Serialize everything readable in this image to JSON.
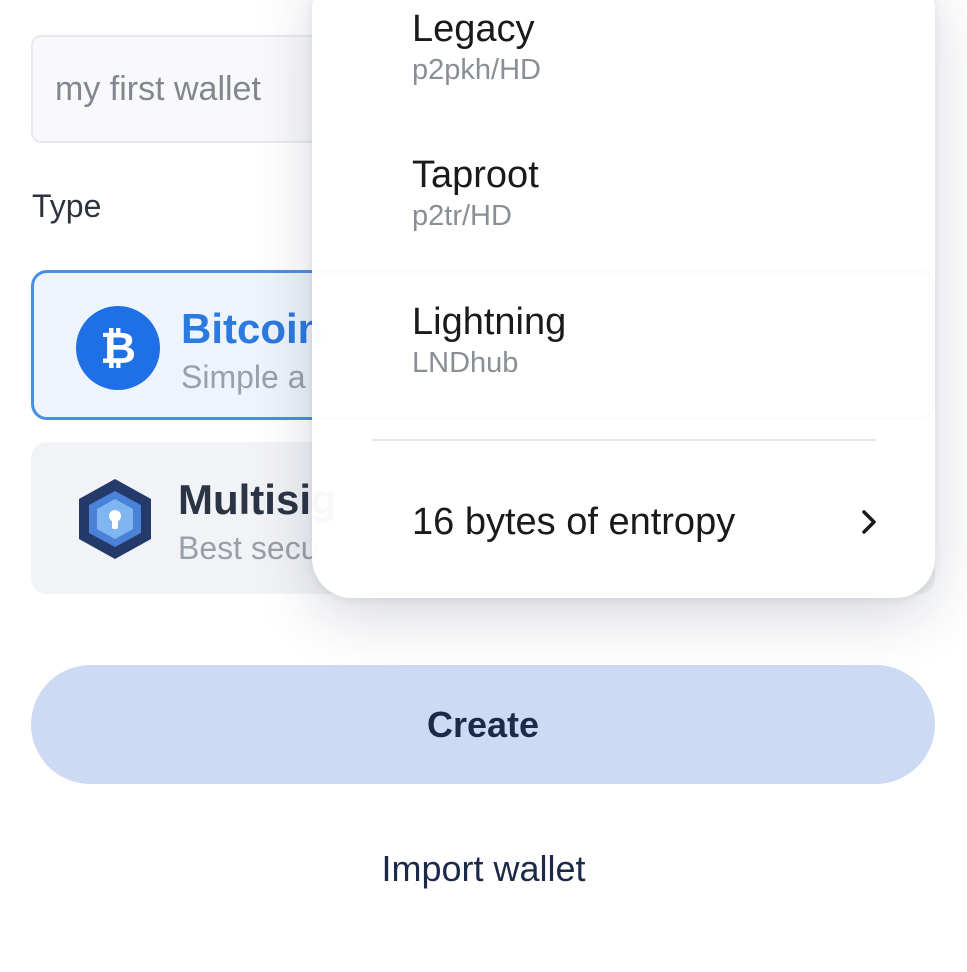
{
  "form": {
    "name_placeholder": "my first wallet",
    "type_label": "Type"
  },
  "wallet_types": [
    {
      "title": "Bitcoin",
      "subtitle": "Simple a",
      "icon": "bitcoin-icon",
      "selected": true
    },
    {
      "title": "Multisig",
      "subtitle": "Best secu",
      "icon": "vault-icon",
      "selected": false
    }
  ],
  "menu": {
    "items": [
      {
        "title": "Legacy",
        "subtitle": "p2pkh/HD"
      },
      {
        "title": "Taproot",
        "subtitle": "p2tr/HD"
      },
      {
        "title": "Lightning",
        "subtitle": "LNDhub"
      }
    ],
    "entropy_label": "16 bytes of entropy",
    "entropy_icon": "chevron-right-icon"
  },
  "actions": {
    "create_label": "Create",
    "import_label": "Import wallet"
  },
  "colors": {
    "accent": "#2b7ae0",
    "selected_border": "#4a90e2",
    "create_bg": "#ccdaf3",
    "dark_text": "#1c2a4a"
  }
}
